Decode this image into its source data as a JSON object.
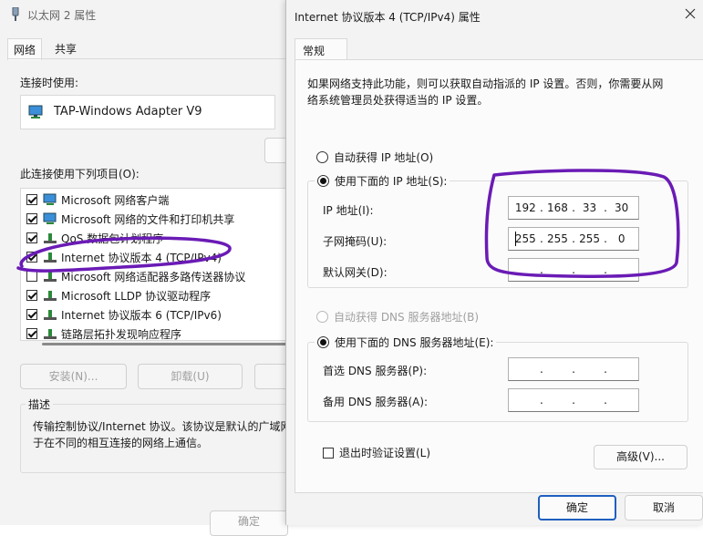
{
  "back_window": {
    "title": "以太网 2 属性",
    "tabs": [
      "网络",
      "共享"
    ],
    "connect_using_label": "连接时使用:",
    "adapter_name": "TAP-Windows Adapter V9",
    "items_label": "此连接使用下列项目(O):",
    "items": [
      {
        "label": "Microsoft 网络客户端",
        "checked": true
      },
      {
        "label": "Microsoft 网络的文件和打印机共享",
        "checked": true
      },
      {
        "label": "QoS 数据包计划程序",
        "checked": true
      },
      {
        "label": "Internet 协议版本 4 (TCP/IPv4)",
        "checked": true
      },
      {
        "label": "Microsoft 网络适配器多路传送器协议",
        "checked": false
      },
      {
        "label": "Microsoft LLDP 协议驱动程序",
        "checked": true
      },
      {
        "label": "Internet 协议版本 6 (TCP/IPv6)",
        "checked": true
      },
      {
        "label": "链路层拓扑发现响应程序",
        "checked": true
      }
    ],
    "install_button": "安装(N)...",
    "uninstall_button": "卸载(U)",
    "description_label": "描述",
    "description_text": "传输控制协议/Internet 协议。该协议是默认的广域网络协议，用于在不同的相互连接的网络上通信。",
    "description_line1": "传输控制协议/Internet 协议。该协议是默认的广域网",
    "description_line2": "于在不同的相互连接的网络上通信。",
    "ok_button": "确定"
  },
  "dialog": {
    "title": "Internet 协议版本 4 (TCP/IPv4) 属性",
    "tab": "常规",
    "intro_line1": "如果网络支持此功能，则可以获取自动指派的 IP 设置。否则，你需要从网",
    "intro_line2": "络系统管理员处获得适当的 IP 设置。",
    "auto_ip": "自动获得 IP 地址(O)",
    "manual_ip": "使用下面的 IP 地址(S):",
    "ip_label": "IP 地址(I):",
    "ip_value": [
      "192",
      "168",
      "33",
      "30"
    ],
    "mask_label": "子网掩码(U):",
    "mask_value": [
      "255",
      "255",
      "255",
      "0"
    ],
    "gateway_label": "默认网关(D):",
    "gateway_value": [
      "",
      "",
      "",
      ""
    ],
    "auto_dns": "自动获得 DNS 服务器地址(B)",
    "manual_dns": "使用下面的 DNS 服务器地址(E):",
    "preferred_dns_label": "首选 DNS 服务器(P):",
    "alternate_dns_label": "备用 DNS 服务器(A):",
    "validate_label": "退出时验证设置(L)",
    "validate_checked": false,
    "advanced_button": "高级(V)...",
    "ok_button": "确定",
    "cancel_button": "取消"
  },
  "colors": {
    "annotation": "#6a1bb5",
    "accent": "#1f5fbf"
  }
}
